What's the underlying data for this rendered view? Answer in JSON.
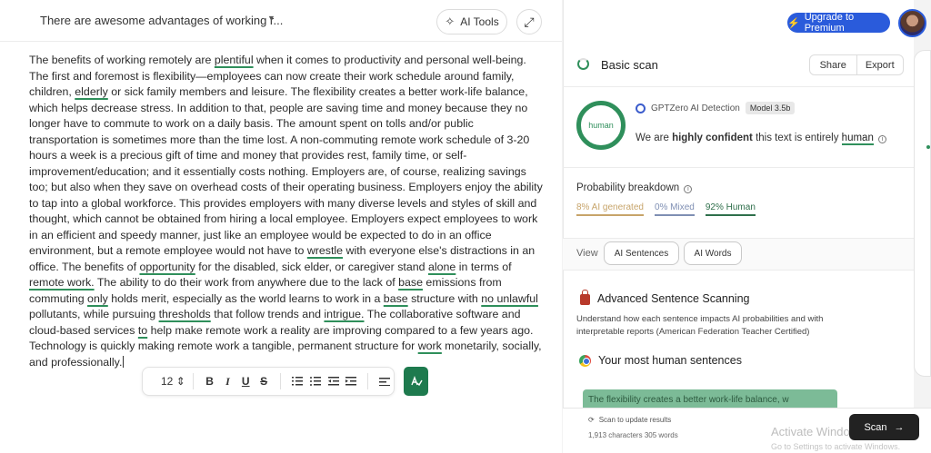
{
  "editor": {
    "doc_title": "There are awesome advantages of working r...",
    "ai_tools_label": "AI Tools",
    "paragraph_segments": [
      {
        "t": "The benefits of working remotely are "
      },
      {
        "t": "plentiful",
        "u": true
      },
      {
        "t": " when it comes to productivity and personal well-being. The first and foremost is flexibility—employees can now create their work schedule around family, children, "
      },
      {
        "t": "elderly",
        "u": true
      },
      {
        "t": " or sick family members and leisure. The flexibility creates a better work-life balance, which helps decrease stress. In addition to that, people are saving time and money because they no longer have to commute to work on a daily basis. The amount spent on tolls and/or public transportation is sometimes more than the time lost. A non-commuting remote work schedule of 3-20 hours a week is a precious gift of time and money that provides rest, family time, or self-improvement/education; and it essentially costs nothing. Employers are, of course, realizing savings too; but also when they save on overhead costs of their operating business. Employers enjoy the ability to tap into a global workforce. This provides employers with many diverse levels and styles of skill and thought, which cannot be obtained from hiring a local employee. Employers expect employees to work in an efficient and speedy manner, just like an employee would be expected to do in an office environment, but a remote employee would not have to "
      },
      {
        "t": "wrestle",
        "u": true
      },
      {
        "t": " with everyone else's distractions in an office. The benefits of "
      },
      {
        "t": "opportunity",
        "u": true
      },
      {
        "t": " for the disabled, sick elder, or caregiver stand "
      },
      {
        "t": "alone",
        "u": true
      },
      {
        "t": " in terms of "
      },
      {
        "t": "remote work.",
        "u": true
      },
      {
        "t": " The ability to do their work from anywhere due to the lack of "
      },
      {
        "t": "base",
        "u": true
      },
      {
        "t": " emissions from commuting "
      },
      {
        "t": "only",
        "u": true
      },
      {
        "t": " holds merit, especially as the world learns to work in a "
      },
      {
        "t": "base",
        "u": true
      },
      {
        "t": " structure with "
      },
      {
        "t": "no unlawful",
        "u": true
      },
      {
        "t": " pollutants, while pursuing "
      },
      {
        "t": "thresholds",
        "u": true
      },
      {
        "t": " that follow trends and "
      },
      {
        "t": "intrigue.",
        "u": true
      },
      {
        "t": " The collaborative software and cloud-based services "
      },
      {
        "t": "to",
        "u": true
      },
      {
        "t": " help make remote work a reality are improving compared to a few years ago. Technology is quickly making remote work a tangible, permanent structure for "
      },
      {
        "t": "work",
        "u": true
      },
      {
        "t": " monetarily, socially, and professionally."
      }
    ],
    "toolbar": {
      "font_size": "12",
      "bold": "B",
      "italic": "I",
      "underline": "U",
      "strike": "S"
    }
  },
  "header": {
    "upgrade_label": "Upgrade to Premium"
  },
  "scan": {
    "title": "Basic scan",
    "share_label": "Share",
    "export_label": "Export",
    "ring_label": "human",
    "detector_name": "GPTZero AI Detection",
    "model_badge": "Model 3.5b",
    "conf_pre": "We are ",
    "conf_bold": "highly confident",
    "conf_mid": " this text is entirely ",
    "conf_result": "human",
    "prob_title": "Probability breakdown",
    "prob_ai": "8% AI generated",
    "prob_mixed": "0% Mixed",
    "prob_human": "92% Human",
    "view_label": "View",
    "view_sentences": "AI Sentences",
    "view_words": "AI Words",
    "adv_title": "Advanced Sentence Scanning",
    "adv_desc": "Understand how each sentence impacts AI probabilities and with interpretable reports (American Federation Teacher Certified)",
    "human_title": "Your most human sentences",
    "human_card_text": "The flexibility creates a better work-life balance, w"
  },
  "footer": {
    "rescan_label": "Scan to update results",
    "counts": "1,913 characters 305 words",
    "scan_label": "Scan",
    "activate_title": "Activate Windows",
    "activate_sub": "Go to Settings to activate Windows."
  },
  "colors": {
    "accent_green": "#2f8f5b",
    "upgrade_blue": "#2a5bdb",
    "lock_red": "#b8392b"
  }
}
